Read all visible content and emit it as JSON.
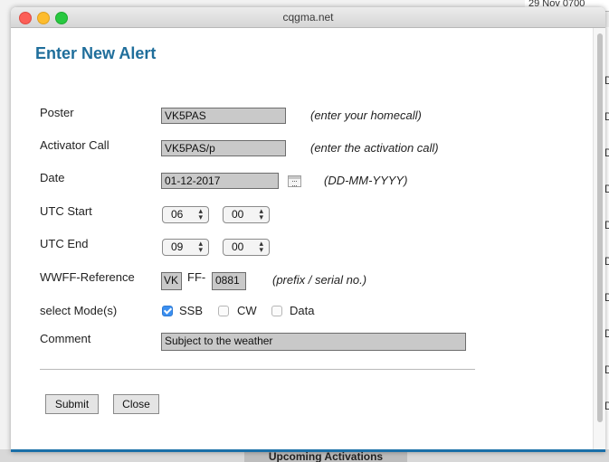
{
  "background": {
    "top_right_text": "29 Nov  0700",
    "right_column_marks": [
      "D",
      "D",
      "D",
      "D",
      "D",
      "D",
      "D",
      "D",
      "D",
      "D"
    ],
    "bottom_label": "Upcoming Activations"
  },
  "window": {
    "title": "cqgma.net"
  },
  "form": {
    "heading": "Enter New Alert",
    "poster": {
      "label": "Poster",
      "value": "VK5PAS",
      "hint": "(enter your homecall)"
    },
    "activator": {
      "label": "Activator Call",
      "value": "VK5PAS/p",
      "hint": "(enter the activation call)"
    },
    "date": {
      "label": "Date",
      "value": "01-12-2017",
      "hint": "(DD-MM-YYYY)",
      "icon": "calendar-icon"
    },
    "utc_start": {
      "label": "UTC Start",
      "hour": "06",
      "minute": "00"
    },
    "utc_end": {
      "label": "UTC End",
      "hour": "09",
      "minute": "00"
    },
    "wwff": {
      "label": "WWFF-Reference",
      "prefix": "VK",
      "separator": "FF-",
      "serial": "0881",
      "hint": "(prefix / serial no.)"
    },
    "modes": {
      "label": "select Mode(s)",
      "options": [
        {
          "label": "SSB",
          "checked": true
        },
        {
          "label": "CW",
          "checked": false
        },
        {
          "label": "Data",
          "checked": false
        }
      ]
    },
    "comment": {
      "label": "Comment",
      "value": "Subject to the weather"
    },
    "buttons": {
      "submit": "Submit",
      "close": "Close"
    }
  },
  "colors": {
    "heading": "#1f6e9b",
    "checkbox_checked": "#3b8ff0",
    "bottom_accent": "#1a6fa8"
  }
}
